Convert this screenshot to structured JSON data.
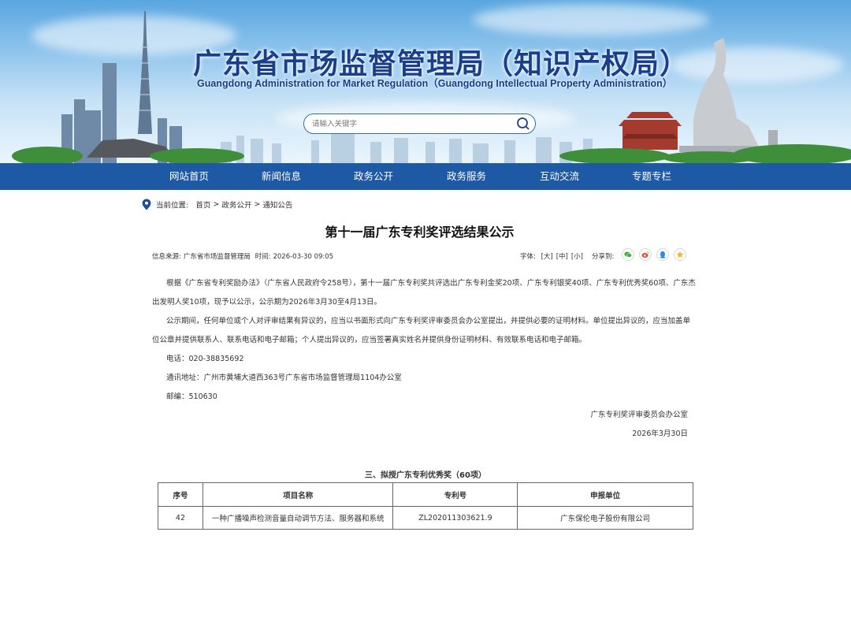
{
  "header": {
    "title": "广东省市场监督管理局（知识产权局）",
    "subtitle": "Guangdong Administration for Market Regulation（Guangdong Intellectual Property Administration）",
    "search_placeholder": "请输入关键字"
  },
  "nav": {
    "items": [
      {
        "label": "网站首页"
      },
      {
        "label": "新闻信息"
      },
      {
        "label": "政务公开"
      },
      {
        "label": "政务服务"
      },
      {
        "label": "互动交流"
      },
      {
        "label": "专题专栏"
      }
    ]
  },
  "breadcrumb": {
    "prefix": "当前位置:",
    "items": [
      "首页",
      "政务公开",
      "通知公告"
    ],
    "separator": ">"
  },
  "article": {
    "title": "第十一届广东专利奖评选结果公示",
    "source_label": "信息来源:",
    "source": "广东省市场监督管理局",
    "time_label": "时间:",
    "time": "2026-03-30 09:05",
    "fontsize_label": "字体:",
    "fontsize_options": [
      "[大]",
      "[中]",
      "[小]"
    ],
    "share_label": "分享到:",
    "paragraphs": [
      "根据《广东省专利奖励办法》（广东省人民政府令258号），第十一届广东专利奖共评选出广东专利金奖20项、广东专利银奖40项、广东专利优秀奖60项、广东杰出发明人奖10项，现予以公示，公示期为2026年3月30至4月13日。",
      "公示期间，任何单位或个人对评审结果有异议的，应当以书面形式向广东专利奖评审委员会办公室提出，并提供必要的证明材料。单位提出异议的，应当加盖单位公章并提供联系人、联系电话和电子邮箱；个人提出异议的，应当签署真实姓名并提供身份证明材料、有效联系电话和电子邮箱。"
    ],
    "phone": "电话：020-38835692",
    "address": "通讯地址：广州市黄埔大道西363号广东省市场监督管理局1104办公室",
    "postcode": "邮编：510630",
    "signature": "广东专利奖评审委员会办公室",
    "date": "2026年3月30日"
  },
  "table": {
    "caption": "三、拟授广东专利优秀奖（60项）",
    "headers": [
      "序号",
      "项目名称",
      "专利号",
      "申报单位"
    ],
    "rows": [
      [
        "42",
        "一种广播噪声检测音量自动调节方法、服务器和系统",
        "ZL202011303621.9",
        "广东保伦电子股份有限公司"
      ]
    ]
  },
  "colors": {
    "nav_bg": "#1d59a5",
    "title_blue": "#1b3e8a"
  },
  "icons": [
    "search-icon",
    "location-icon",
    "wechat-icon",
    "weibo-icon",
    "qq-icon",
    "qzone-icon"
  ]
}
